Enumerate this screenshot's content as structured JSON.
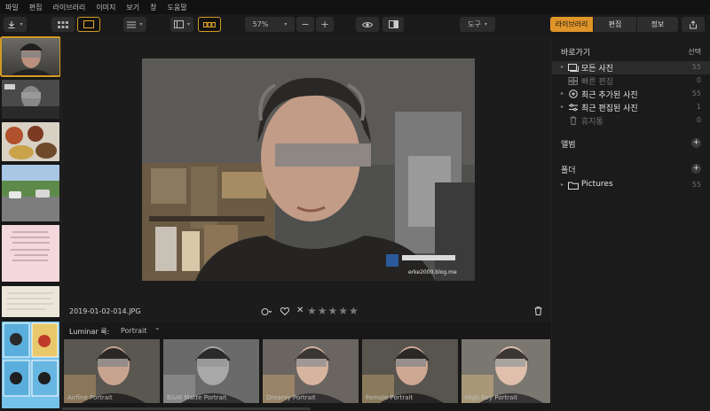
{
  "menu": [
    "파일",
    "편집",
    "라이브러리",
    "이미지",
    "보기",
    "창",
    "도움말"
  ],
  "toolbar": {
    "zoom": "57%",
    "minus": "−",
    "plus": "+",
    "tools": "도구",
    "tabs": [
      "라이브러리",
      "편집",
      "정보"
    ]
  },
  "image": {
    "filename": "2019-01-02-014.JPG",
    "stars": "★★★★★",
    "reject": "✕",
    "watermark": "erke2000.blog.me"
  },
  "looks": {
    "label": "Luminar 룩:",
    "category": "Portrait",
    "items": [
      "Airfine Portrait",
      "B&W Matte Portrait",
      "Dreamy Portrait",
      "Female Portrait",
      "High Key Portrait"
    ]
  },
  "panel": {
    "shortcuts_title": "바로가기",
    "select": "선택",
    "items": [
      {
        "label": "모든 사진",
        "count": "55"
      },
      {
        "label": "빠른 편집",
        "count": "0"
      },
      {
        "label": "최근 추가된 사진",
        "count": "55"
      },
      {
        "label": "최근 편집된 사진",
        "count": "1"
      },
      {
        "label": "휴지통",
        "count": "0"
      }
    ],
    "albums_title": "앨범",
    "folders_title": "폴더",
    "folder": {
      "label": "Pictures",
      "count": "55"
    }
  },
  "colors": {
    "accent": "#e0952a",
    "background": "#202020"
  }
}
